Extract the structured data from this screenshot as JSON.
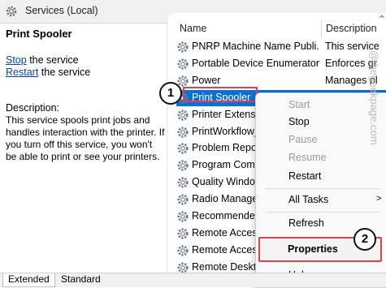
{
  "window": {
    "title": "Services (Local)",
    "icon": "gear-icon"
  },
  "left_pane": {
    "service_name": "Print Spooler",
    "actions": [
      {
        "link": "Stop",
        "rest": " the service"
      },
      {
        "link": "Restart",
        "rest": " the service"
      }
    ],
    "description_label": "Description:",
    "description": "This service spools print jobs and handles interaction with the printer. If you turn off this service, you won't be able to print or see your printers."
  },
  "list": {
    "columns": [
      "Name",
      "Description"
    ],
    "rows": [
      {
        "name": "PNRP Machine Name Publi...",
        "description": "This service"
      },
      {
        "name": "Portable Device Enumerator...",
        "description": "Enforces gr"
      },
      {
        "name": "Power",
        "description": "Manages pl"
      },
      {
        "name": "Print Spooler",
        "description": "",
        "selected": true
      },
      {
        "name": "Printer Extensio",
        "description": ""
      },
      {
        "name": "PrintWorkflow_",
        "description": ""
      },
      {
        "name": "Problem Report",
        "description": ""
      },
      {
        "name": "Program Comp",
        "description": ""
      },
      {
        "name": "Quality Window",
        "description": ""
      },
      {
        "name": "Radio Manage",
        "description": ""
      },
      {
        "name": "Recommended",
        "description": ""
      },
      {
        "name": "Remote Access",
        "description": ""
      },
      {
        "name": "Remote Access",
        "description": ""
      },
      {
        "name": "Remote Deskto",
        "description": ""
      }
    ]
  },
  "context_menu": {
    "items": [
      {
        "label": "Start",
        "disabled": true
      },
      {
        "label": "Stop",
        "disabled": false
      },
      {
        "label": "Pause",
        "disabled": true
      },
      {
        "label": "Resume",
        "disabled": true
      },
      {
        "label": "Restart",
        "disabled": false
      },
      {
        "label": "All Tasks",
        "disabled": false,
        "submenu": true
      },
      {
        "label": "Refresh",
        "disabled": false
      },
      {
        "label": "Properties",
        "disabled": false,
        "bold": true
      },
      {
        "label": "Help",
        "disabled": false
      }
    ],
    "submenu_arrow": ">"
  },
  "annotations": {
    "step1": "1",
    "step2": "2"
  },
  "tabs": [
    "Extended",
    "Standard"
  ],
  "active_tab": "Extended",
  "watermark": "@thegeekpage.com",
  "colors": {
    "selection": "#0b6fd8",
    "highlight_box": "#e0404e",
    "link": "#0645ad"
  }
}
